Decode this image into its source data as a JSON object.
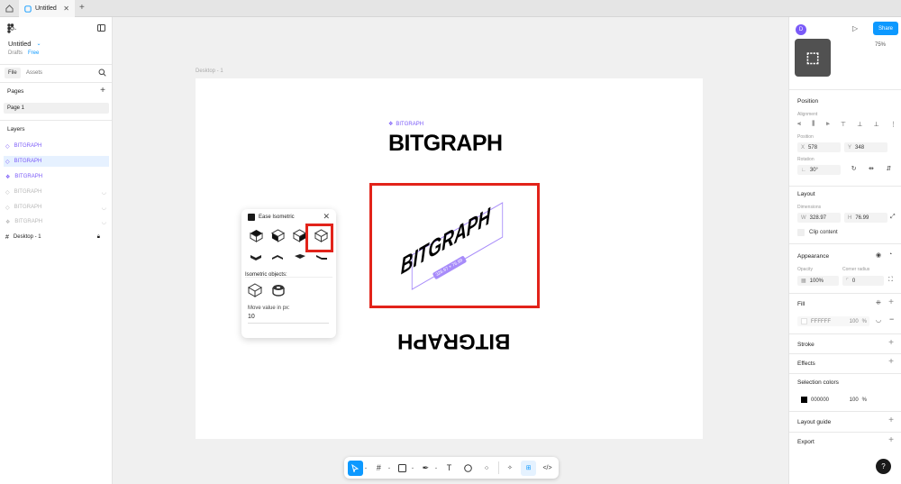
{
  "tab_bar": {
    "tab_title": "Untitled"
  },
  "file": {
    "name": "Untitled",
    "location": "Drafts",
    "plan": "Free"
  },
  "left_tabs": {
    "file": "File",
    "assets": "Assets"
  },
  "pages": {
    "heading": "Pages",
    "items": [
      "Page 1"
    ]
  },
  "layers": {
    "heading": "Layers",
    "items": [
      {
        "label": "BITGRAPH",
        "state": "normal"
      },
      {
        "label": "BITGRAPH",
        "state": "selected"
      },
      {
        "label": "BITGRAPH",
        "state": "component"
      },
      {
        "label": "BITGRAPH",
        "state": "hidden"
      },
      {
        "label": "BITGRAPH",
        "state": "hidden"
      },
      {
        "label": "BITGRAPH",
        "state": "hidden"
      },
      {
        "label": "Desktop - 1",
        "state": "frame"
      }
    ]
  },
  "canvas": {
    "frame_label": "Desktop - 1",
    "component_label": "BITGRAPH",
    "title_text": "BITGRAPH",
    "skewed_text": "BITGRAPH",
    "dimension_badge": "328.97 × 76.99",
    "mirrored_text": "BITGRAPH"
  },
  "plugin": {
    "title": "Ease Isometric",
    "objects_label": "Isometric objects:",
    "move_label": "Move value in px:",
    "move_value": "10"
  },
  "right_panel": {
    "share_label": "Share",
    "zoom": "75%",
    "avatar_letter": "D",
    "position_heading": "Position",
    "alignment_label": "Alignment",
    "position_label": "Position",
    "x_key": "X",
    "x_value": "578",
    "y_key": "Y",
    "y_value": "348",
    "rotation_label": "Rotation",
    "rotation_value": "30°",
    "layout_heading": "Layout",
    "dimensions_label": "Dimensions",
    "w_key": "W",
    "w_value": "328.97",
    "h_key": "H",
    "h_value": "76.99",
    "clip_label": "Clip content",
    "appearance_heading": "Appearance",
    "opacity_label": "Opacity",
    "opacity_value": "100%",
    "radius_label": "Corner radius",
    "radius_value": "0",
    "fill_heading": "Fill",
    "fill_hex": "FFFFFF",
    "fill_opacity": "100",
    "fill_unit": "%",
    "stroke_heading": "Stroke",
    "effects_heading": "Effects",
    "selection_colors_heading": "Selection colors",
    "sel_hex": "000000",
    "sel_opacity": "100",
    "sel_unit": "%",
    "layout_guide_heading": "Layout guide",
    "export_heading": "Export",
    "help": "?"
  },
  "colors": {
    "accent": "#0d99ff",
    "purple": "#7a5af8",
    "highlight": "#e2231a"
  }
}
